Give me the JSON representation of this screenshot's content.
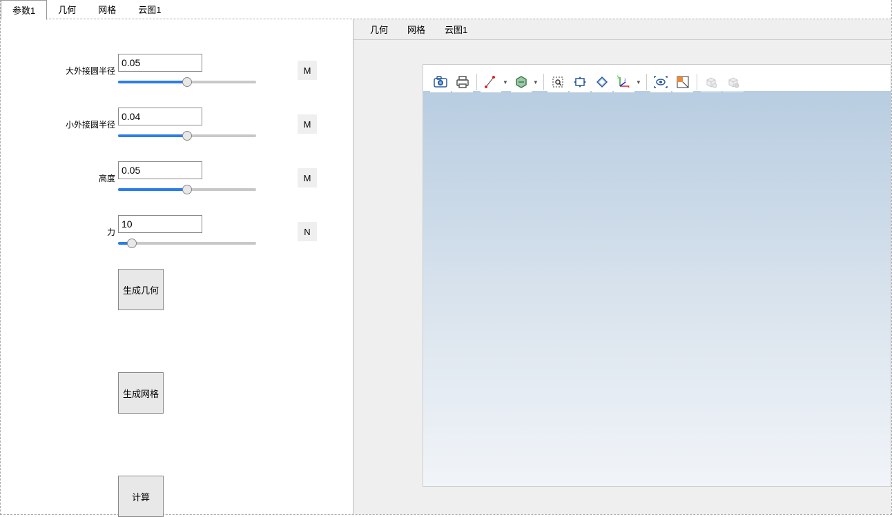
{
  "tabs_top": [
    {
      "label": "参数1",
      "active": true
    },
    {
      "label": "几何",
      "active": false
    },
    {
      "label": "网格",
      "active": false
    },
    {
      "label": "云图1",
      "active": false
    }
  ],
  "params": [
    {
      "label": "大外接圆半径",
      "value": "0.05",
      "unit": "M",
      "slider_percent": 50
    },
    {
      "label": "小外接圆半径",
      "value": "0.04",
      "unit": "M",
      "slider_percent": 50
    },
    {
      "label": "高度",
      "value": "0.05",
      "unit": "M",
      "slider_percent": 50
    },
    {
      "label": "力",
      "value": "10",
      "unit": "N",
      "slider_percent": 10
    }
  ],
  "buttons": {
    "gen_geom": "生成几何",
    "gen_mesh": "生成网格",
    "compute": "计算"
  },
  "tabs_right": [
    {
      "label": "几何"
    },
    {
      "label": "网格"
    },
    {
      "label": "云图1"
    }
  ],
  "toolbar_icons": [
    "camera-icon",
    "print-icon",
    "line-tool-icon",
    "hexagon-icon",
    "zoom-select-icon",
    "pan-icon",
    "zoom-extents-icon",
    "axis-xyz-icon",
    "eye-view-icon",
    "wireframe-toggle-icon",
    "cube-light-icon",
    "cube-shadow-icon"
  ]
}
